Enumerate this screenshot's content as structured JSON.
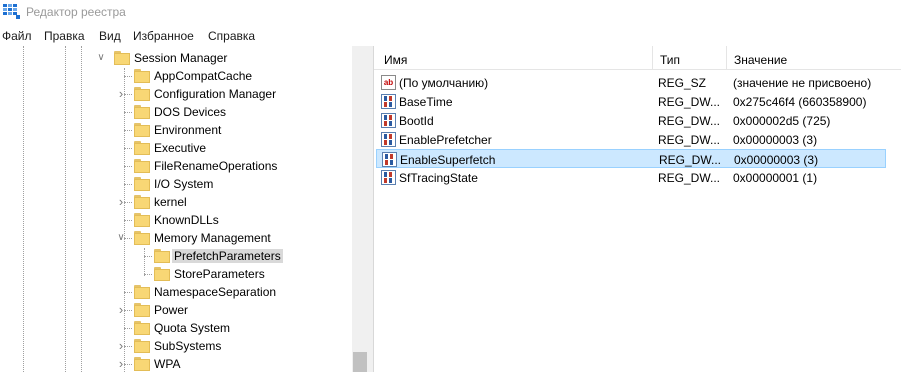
{
  "window": {
    "title": "Редактор реестра",
    "icon": "registry-editor-icon"
  },
  "menu": [
    "Файл",
    "Правка",
    "Вид",
    "Избранное",
    "Справка"
  ],
  "tree": {
    "nodes": [
      {
        "label": "Session Manager",
        "expander": "expanded",
        "level": 0,
        "selected": false
      },
      {
        "label": "AppCompatCache",
        "expander": "none",
        "level": 1,
        "selected": false
      },
      {
        "label": "Configuration Manager",
        "expander": "collapsed",
        "level": 1,
        "selected": false
      },
      {
        "label": "DOS Devices",
        "expander": "none",
        "level": 1,
        "selected": false
      },
      {
        "label": "Environment",
        "expander": "none",
        "level": 1,
        "selected": false
      },
      {
        "label": "Executive",
        "expander": "none",
        "level": 1,
        "selected": false
      },
      {
        "label": "FileRenameOperations",
        "expander": "none",
        "level": 1,
        "selected": false
      },
      {
        "label": "I/O System",
        "expander": "none",
        "level": 1,
        "selected": false
      },
      {
        "label": "kernel",
        "expander": "collapsed",
        "level": 1,
        "selected": false
      },
      {
        "label": "KnownDLLs",
        "expander": "none",
        "level": 1,
        "selected": false
      },
      {
        "label": "Memory Management",
        "expander": "expanded",
        "level": 1,
        "selected": false
      },
      {
        "label": "PrefetchParameters",
        "expander": "none",
        "level": 2,
        "selected": true
      },
      {
        "label": "StoreParameters",
        "expander": "none",
        "level": 2,
        "selected": false
      },
      {
        "label": "NamespaceSeparation",
        "expander": "none",
        "level": 1,
        "selected": false
      },
      {
        "label": "Power",
        "expander": "collapsed",
        "level": 1,
        "selected": false
      },
      {
        "label": "Quota System",
        "expander": "none",
        "level": 1,
        "selected": false
      },
      {
        "label": "SubSystems",
        "expander": "collapsed",
        "level": 1,
        "selected": false
      },
      {
        "label": "WPA",
        "expander": "collapsed",
        "level": 1,
        "selected": false
      }
    ]
  },
  "list": {
    "columns": {
      "name": "Имя",
      "type": "Тип",
      "value": "Значение"
    },
    "rows": [
      {
        "icon": "string-value-icon",
        "name": "(По умолчанию)",
        "type": "REG_SZ",
        "value": "(значение не присвоено)",
        "selected": false
      },
      {
        "icon": "binary-value-icon",
        "name": "BaseTime",
        "type": "REG_DW...",
        "value": "0x275c46f4 (660358900)",
        "selected": false
      },
      {
        "icon": "binary-value-icon",
        "name": "BootId",
        "type": "REG_DW...",
        "value": "0x000002d5 (725)",
        "selected": false
      },
      {
        "icon": "binary-value-icon",
        "name": "EnablePrefetcher",
        "type": "REG_DW...",
        "value": "0x00000003 (3)",
        "selected": false
      },
      {
        "icon": "binary-value-icon",
        "name": "EnableSuperfetch",
        "type": "REG_DW...",
        "value": "0x00000003 (3)",
        "selected": true
      },
      {
        "icon": "binary-value-icon",
        "name": "SfTracingState",
        "type": "REG_DW...",
        "value": "0x00000001 (1)",
        "selected": false
      }
    ]
  },
  "colors": {
    "selection_bg": "#cce8ff",
    "selection_border": "#99d1ff",
    "tree_selection_bg": "#d9d9d9",
    "folder": "#f8d775"
  }
}
